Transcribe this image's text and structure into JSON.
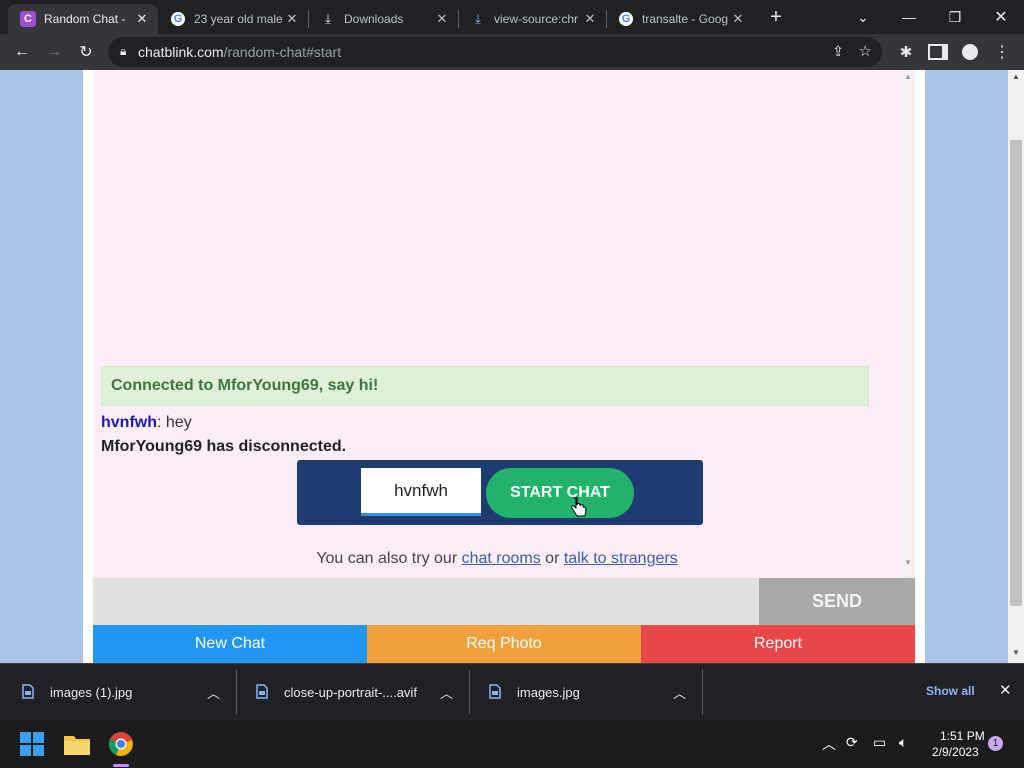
{
  "browser": {
    "tabs": [
      {
        "title": "Random Chat - ",
        "favicon": "chatblink-icon",
        "active": true
      },
      {
        "title": "23 year old male",
        "favicon": "google-icon"
      },
      {
        "title": "Downloads",
        "favicon": "download-icon"
      },
      {
        "title": "view-source:chr",
        "favicon": "download-icon"
      },
      {
        "title": "transalte - Goog",
        "favicon": "google-icon"
      }
    ],
    "url_domain": "chatblink.com",
    "url_path": "/random-chat#start"
  },
  "chat": {
    "connected_message": "Connected to MforYoung69, say hi!",
    "messages": [
      {
        "user": "hvnfwh",
        "sep": ":",
        "text": " hey"
      }
    ],
    "disconnect_message": "MforYoung69 has disconnected.",
    "name_input_value": "hvnfwh",
    "start_button": "START CHAT",
    "also_try_prefix": "You can also try our ",
    "chat_rooms_link": "chat rooms",
    "or_text": " or ",
    "strangers_link": "talk to strangers",
    "send_button": "SEND",
    "new_chat_button": "New Chat",
    "req_photo_button": "Req Photo",
    "report_button": "Report",
    "colors": {
      "new_chat": "#2196f3",
      "req_photo": "#f0a03c",
      "report": "#e8474a",
      "start": "#21b36a"
    }
  },
  "downloads": {
    "items": [
      {
        "name": "images (1).jpg"
      },
      {
        "name": "close-up-portrait-....avif"
      },
      {
        "name": "images.jpg"
      }
    ],
    "show_all": "Show all"
  },
  "taskbar": {
    "time": "1:51 PM",
    "date": "2/9/2023",
    "notification_count": "1"
  }
}
